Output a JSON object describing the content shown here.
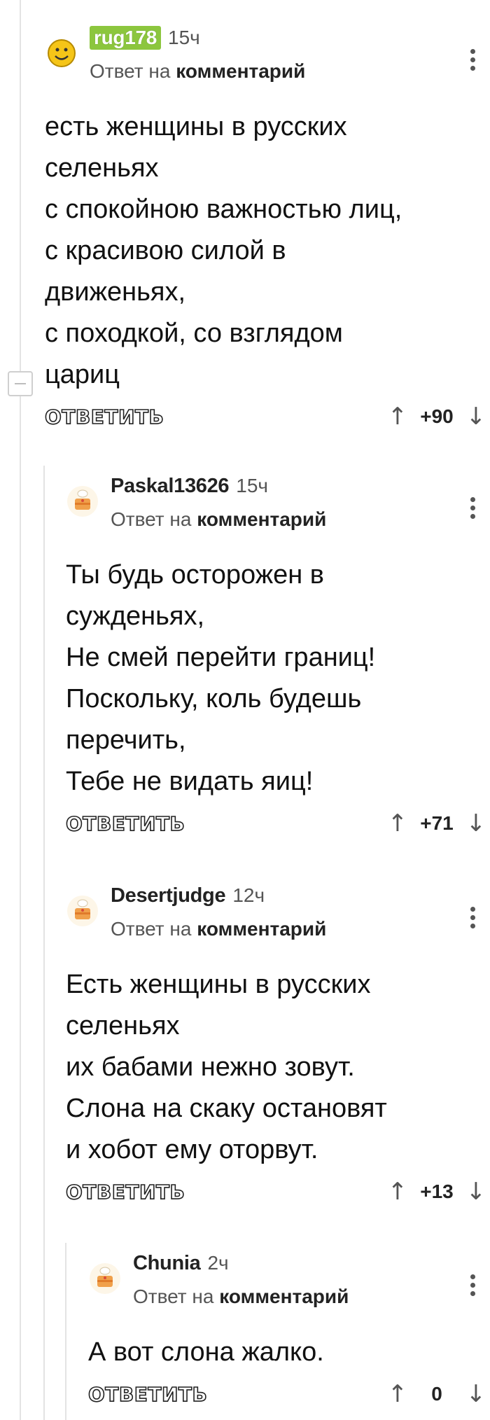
{
  "comments": [
    {
      "username": "rug178",
      "time": "15ч",
      "reply_prefix": "Ответ на",
      "reply_target": "комментарий",
      "lines": [
        "есть женщины в русских",
        "селеньях",
        "с спокойною важностью лиц,",
        "с красивою силой в",
        "движеньях,",
        "с походкой, со взглядом",
        "цариц"
      ],
      "reply_label": "ОТВЕТИТЬ",
      "up_icon": "arrow-up-icon",
      "rating": "+90",
      "down_icon": "arrow-down-icon"
    },
    {
      "username": "Paskal13626",
      "time": "15ч",
      "reply_prefix": "Ответ на",
      "reply_target": "комментарий",
      "lines": [
        "Ты будь осторожен в",
        "сужденьях,",
        "Не смей перейти границ!",
        "Поскольку, коль будешь",
        "перечить,",
        "Тебе не видать яиц!"
      ],
      "reply_label": "ОТВЕТИТЬ",
      "rating": "+71"
    },
    {
      "username": "Desertjudge",
      "time": "12ч",
      "reply_prefix": "Ответ на",
      "reply_target": "комментарий",
      "lines": [
        "Есть женщины в русских",
        "селеньях",
        "их бабами нежно зовут.",
        "Слона на скаку остановят",
        "и хобот ему оторвут."
      ],
      "reply_label": "ОТВЕТИТЬ",
      "rating": "+13"
    },
    {
      "username": "Chunia",
      "time": "2ч",
      "reply_prefix": "Ответ на",
      "reply_target": "комментарий",
      "lines": [
        "А вот слона жалко."
      ],
      "reply_label": "ОТВЕТИТЬ",
      "rating": "0"
    }
  ],
  "icons": {
    "more": "more-vertical-icon",
    "collapse": "collapse-minus-icon",
    "avatar_first": "smiley-avatar-icon",
    "avatar_default": "chef-cake-avatar-icon"
  },
  "colors": {
    "badge_bg": "#8cc63e",
    "thread_line": "#e3e3e3"
  }
}
